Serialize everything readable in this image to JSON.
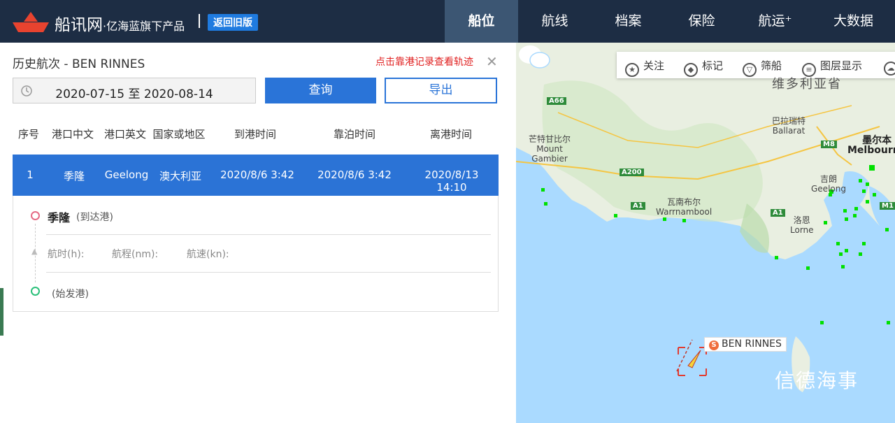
{
  "header": {
    "brand": "船讯网",
    "brand_sub": "·亿海蓝旗下产品",
    "old_version": "返回旧版",
    "nav": [
      "船位",
      "航线",
      "档案",
      "保险",
      "航运⁺",
      "大数据"
    ]
  },
  "panel": {
    "title": "历史航次 - BEN RINNES",
    "hint": "点击靠港记录查看轨迹",
    "close": "✕",
    "date_range": "2020-07-15 至 2020-08-14",
    "query_button": "查询",
    "export_button": "导出",
    "columns": [
      "序号",
      "港口中文",
      "港口英文",
      "国家或地区",
      "到港时间",
      "靠泊时间",
      "离港时间"
    ],
    "rows": [
      {
        "no": "1",
        "port_cn": "季隆",
        "port_en": "Geelong",
        "country": "澳大利亚",
        "arrival": "2020/8/6 3:42",
        "berth": "2020/8/6 3:42",
        "departure": "2020/8/13 14:10"
      }
    ],
    "detail": {
      "port": "季隆",
      "arrive_tag": "(到达港)",
      "duration_label": "航时(h):",
      "distance_label": "航程(nm):",
      "speed_label": "航速(kn):",
      "depart_tag": "(始发港)"
    }
  },
  "map": {
    "toolbar": [
      "关注",
      "标记",
      "筛船",
      "图层显示"
    ],
    "labels": {
      "victoria": "维多利亚省",
      "ballarat_cn": "巴拉瑞特",
      "ballarat_en": "Ballarat",
      "melbourne_cn": "墨尔本",
      "melbourne_en": "Melbourne",
      "geelong_cn": "吉朗",
      "geelong_en": "Geelong",
      "gambier_cn": "芒特甘比尔",
      "gambier_en1": "Mount",
      "gambier_en2": "Gambier",
      "warrnambool_cn": "瓦南布尔",
      "warrnambool_en": "Warrnambool",
      "lorne_cn": "洛恩",
      "lorne_en": "Lorne"
    },
    "roads": [
      "A66",
      "M8",
      "A200",
      "A1",
      "A1",
      "M1"
    ],
    "ship_badge": "S",
    "ship_name": "BEN RINNES",
    "watermark": "信德海事",
    "colors": {
      "sea": "#aadaff",
      "land": "#f2efe9",
      "ship_marker": "#00e000",
      "nav_bg": "#1d2d44",
      "accent": "#2a74d8"
    }
  }
}
